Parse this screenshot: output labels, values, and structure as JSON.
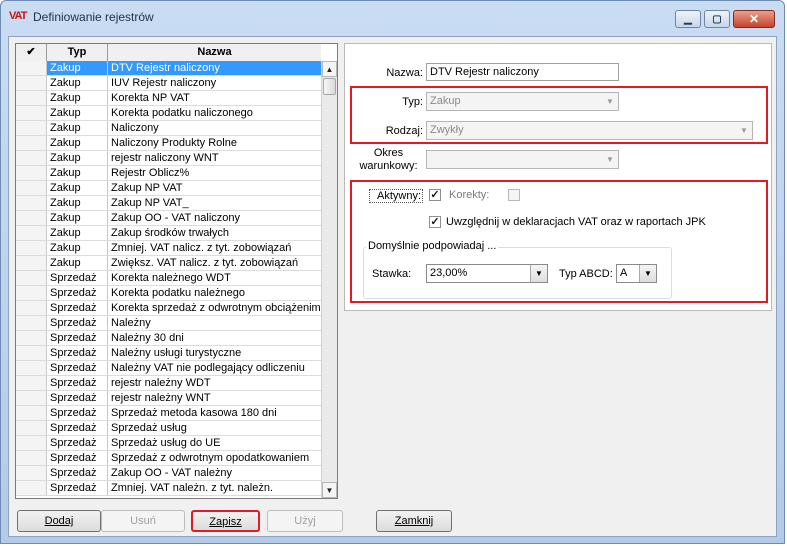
{
  "window": {
    "title": "Definiowanie rejestrów",
    "icon_text": "VAT"
  },
  "list": {
    "headers": {
      "check": "✔",
      "typ": "Typ",
      "nazwa": "Nazwa"
    },
    "rows": [
      {
        "typ": "Zakup",
        "nazwa": "DTV Rejestr naliczony",
        "selected": true
      },
      {
        "typ": "Zakup",
        "nazwa": "IUV Rejestr naliczony"
      },
      {
        "typ": "Zakup",
        "nazwa": "Korekta NP VAT"
      },
      {
        "typ": "Zakup",
        "nazwa": "Korekta podatku naliczonego"
      },
      {
        "typ": "Zakup",
        "nazwa": "Naliczony"
      },
      {
        "typ": "Zakup",
        "nazwa": "Naliczony Produkty Rolne"
      },
      {
        "typ": "Zakup",
        "nazwa": "rejestr naliczony WNT"
      },
      {
        "typ": "Zakup",
        "nazwa": "Rejestr Oblicz%"
      },
      {
        "typ": "Zakup",
        "nazwa": "Zakup NP VAT"
      },
      {
        "typ": "Zakup",
        "nazwa": "Zakup NP VAT_"
      },
      {
        "typ": "Zakup",
        "nazwa": "Zakup OO - VAT naliczony"
      },
      {
        "typ": "Zakup",
        "nazwa": "Zakup środków trwałych"
      },
      {
        "typ": "Zakup",
        "nazwa": "Zmniej. VAT nalicz. z tyt. zobowiązań"
      },
      {
        "typ": "Zakup",
        "nazwa": "Zwiększ. VAT nalicz. z tyt. zobowiązań"
      },
      {
        "typ": "Sprzedaż",
        "nazwa": "Korekta należnego WDT"
      },
      {
        "typ": "Sprzedaż",
        "nazwa": "Korekta podatku należnego"
      },
      {
        "typ": "Sprzedaż",
        "nazwa": "Korekta sprzedaż z odwrotnym obciążenim"
      },
      {
        "typ": "Sprzedaż",
        "nazwa": "Należny"
      },
      {
        "typ": "Sprzedaż",
        "nazwa": "Należny 30 dni"
      },
      {
        "typ": "Sprzedaż",
        "nazwa": "Należny usługi turystyczne"
      },
      {
        "typ": "Sprzedaż",
        "nazwa": "Należny VAT nie podlegający odliczeniu"
      },
      {
        "typ": "Sprzedaż",
        "nazwa": "rejestr należny WDT"
      },
      {
        "typ": "Sprzedaż",
        "nazwa": "rejestr należny WNT"
      },
      {
        "typ": "Sprzedaż",
        "nazwa": "Sprzedaż metoda kasowa 180 dni"
      },
      {
        "typ": "Sprzedaż",
        "nazwa": "Sprzedaż usług"
      },
      {
        "typ": "Sprzedaż",
        "nazwa": "Sprzedaż usług do UE"
      },
      {
        "typ": "Sprzedaż",
        "nazwa": "Sprzedaż z odwrotnym opodatkowaniem"
      },
      {
        "typ": "Sprzedaż",
        "nazwa": "Zakup OO - VAT należny"
      },
      {
        "typ": "Sprzedaż",
        "nazwa": "Zmniej. VAT należn. z tyt. należn."
      }
    ]
  },
  "form": {
    "nazwa_label": "Nazwa:",
    "nazwa_value": "DTV Rejestr naliczony",
    "typ_label": "Typ:",
    "typ_value": "Zakup",
    "rodzaj_label": "Rodzaj:",
    "rodzaj_value": "Zwykły",
    "okres_label_1": "Okres",
    "okres_label_2": "warunkowy:",
    "okres_value": "",
    "aktywny_label": "Aktywny:",
    "aktywny_checked": true,
    "korekty_label": "Korekty:",
    "korekty_checked": false,
    "uwzglednij_label": "Uwzględnij w deklaracjach VAT oraz w raportach JPK",
    "uwzglednij_checked": true,
    "group_label": "Domyślnie podpowiadaj ...",
    "stawka_label": "Stawka:",
    "stawka_value": "23,00%",
    "typ_abcd_label": "Typ ABCD:",
    "typ_abcd_value": "A"
  },
  "buttons": {
    "dodaj": "Dodaj",
    "usun": "Usuń",
    "zapisz": "Zapisz",
    "uzyj": "Użyj",
    "zamknij": "Zamknij"
  },
  "colors": {
    "highlight": "#e01b24",
    "selection": "#3399ff"
  }
}
